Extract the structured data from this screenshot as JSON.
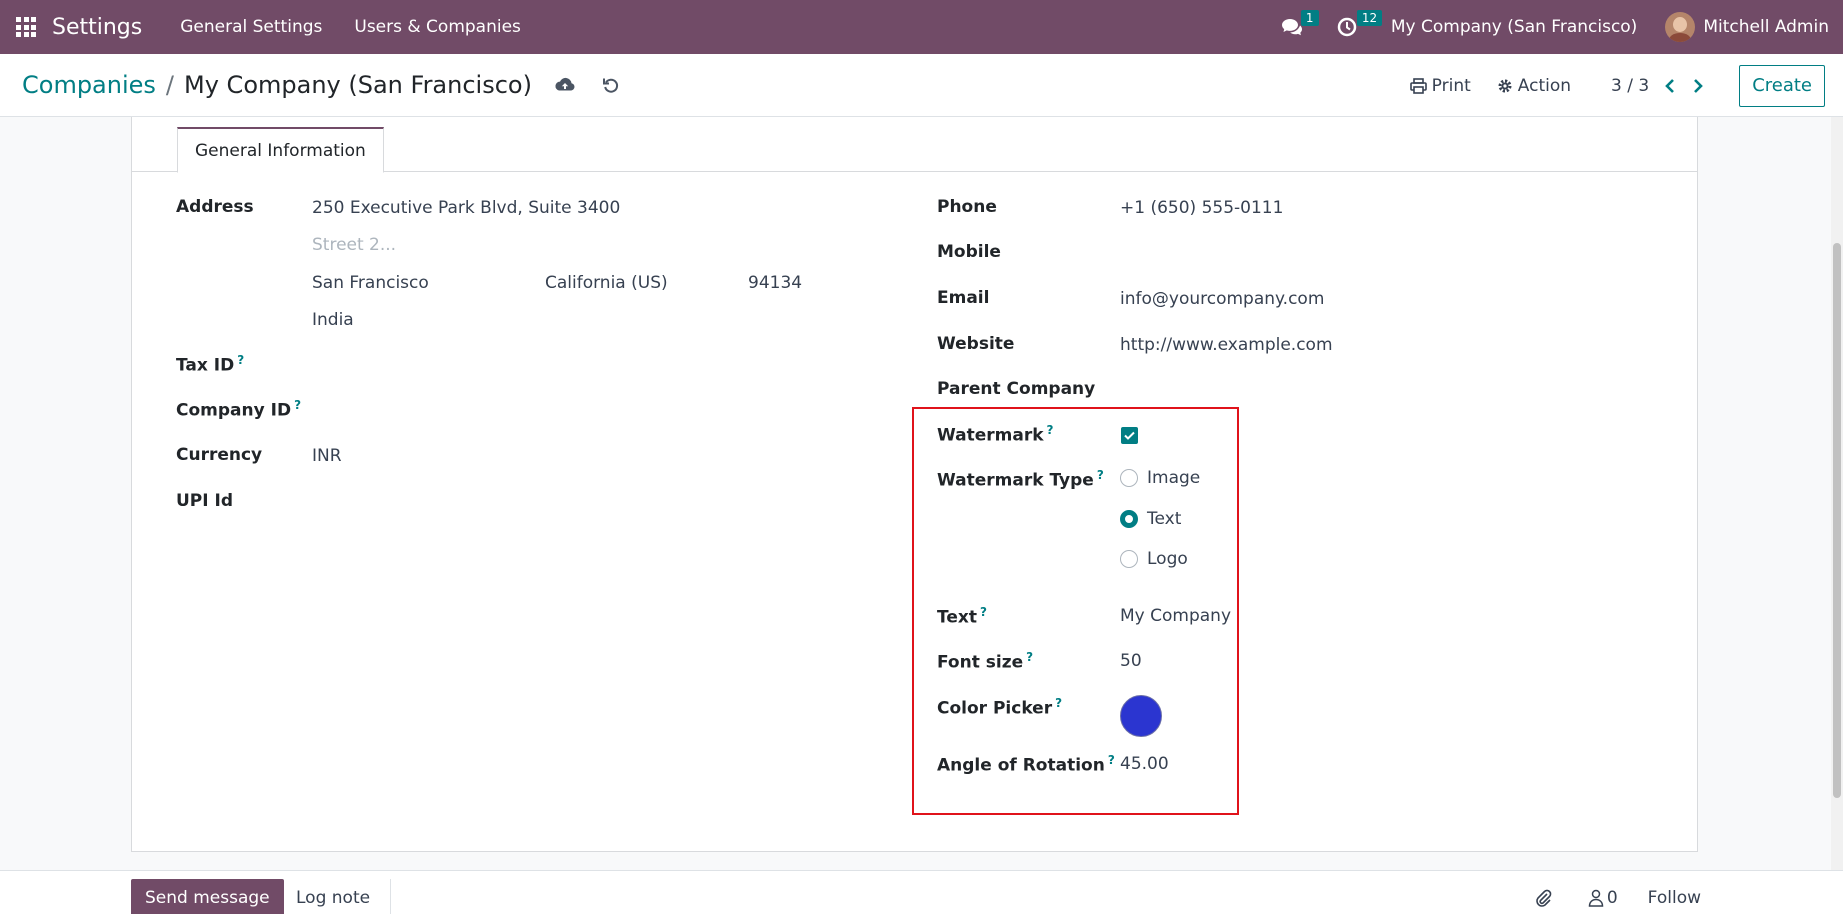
{
  "navbar": {
    "brand": "Settings",
    "menus": [
      "General Settings",
      "Users & Companies"
    ],
    "messages_badge": "1",
    "activities_badge": "12",
    "company": "My Company (San Francisco)",
    "user": "Mitchell Admin"
  },
  "control_panel": {
    "breadcrumb_parent": "Companies",
    "breadcrumb_separator": "/",
    "breadcrumb_current": "My Company (San Francisco)",
    "print_label": "Print",
    "action_label": "Action",
    "pager": "3 / 3",
    "create_label": "Create"
  },
  "form": {
    "tab_label": "General Information",
    "address": {
      "label": "Address",
      "street": "250 Executive Park Blvd, Suite 3400",
      "street2_placeholder": "Street 2...",
      "city": "San Francisco",
      "state": "California (US)",
      "zip": "94134",
      "country": "India"
    },
    "tax_id": {
      "label": "Tax ID",
      "value": ""
    },
    "company_id": {
      "label": "Company ID",
      "value": ""
    },
    "currency": {
      "label": "Currency",
      "value": "INR"
    },
    "upi_id": {
      "label": "UPI Id",
      "value": ""
    },
    "phone": {
      "label": "Phone",
      "value": "+1 (650) 555-0111"
    },
    "mobile": {
      "label": "Mobile",
      "value": ""
    },
    "email": {
      "label": "Email",
      "value": "info@yourcompany.com"
    },
    "website": {
      "label": "Website",
      "value": "http://www.example.com"
    },
    "parent_company": {
      "label": "Parent Company",
      "value": ""
    },
    "watermark": {
      "label": "Watermark",
      "checked": true
    },
    "watermark_type": {
      "label": "Watermark Type",
      "options": [
        "Image",
        "Text",
        "Logo"
      ],
      "selected": "Text"
    },
    "text": {
      "label": "Text",
      "value": "My Company"
    },
    "font_size": {
      "label": "Font size",
      "value": "50"
    },
    "color_picker": {
      "label": "Color Picker",
      "value": "#2b35d0"
    },
    "angle": {
      "label": "Angle of Rotation",
      "value": "45.00"
    },
    "help_marker": "?"
  },
  "chatter": {
    "send_message": "Send message",
    "log_note": "Log note",
    "followers_count": "0",
    "follow_label": "Follow"
  },
  "colors": {
    "brand": "#714b67",
    "accent": "#017e84",
    "highlight_border": "#e0131b"
  }
}
